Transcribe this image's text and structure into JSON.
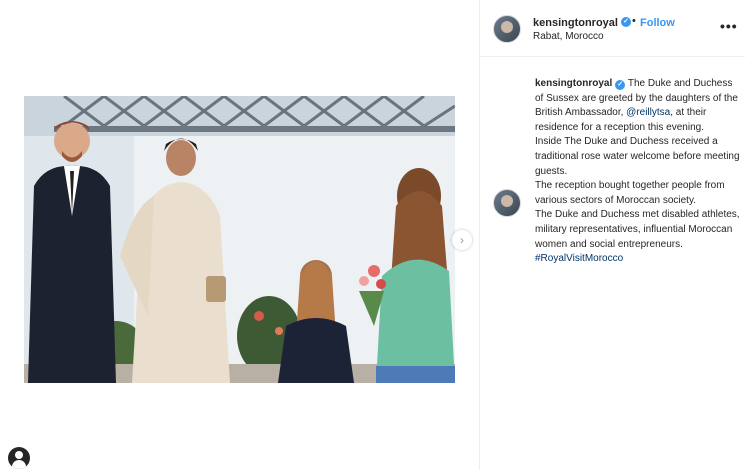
{
  "post": {
    "username": "kensingtonroyal",
    "follow_label": "Follow",
    "separator": "•",
    "location": "Rabat, Morocco",
    "more_label": "•••",
    "next_label": "›"
  },
  "caption": {
    "username": "kensingtonroyal",
    "line1": "The Duke and Duchess of Sussex are greeted by the daughters of the British Ambassador,",
    "mention": "@reillytsa",
    "line1_end": ", at their residence for a reception this evening.",
    "para2": "Inside The Duke and Duchess received a traditional rose water welcome before meeting guests.",
    "para3": "The reception bought together people from various sectors of Moroccan society.",
    "para4": "The Duke and Duchess met disabled athletes, military representatives, influential Moroccan women and social entrepreneurs.",
    "hashtag": "#RoyalVisitMorocco"
  },
  "colors": {
    "link_blue": "#3897f0",
    "mention_blue": "#003569",
    "text": "#262626"
  },
  "icons": [
    "verified-badge-icon",
    "more-options-icon",
    "next-arrow-icon",
    "user-avatar-icon"
  ]
}
